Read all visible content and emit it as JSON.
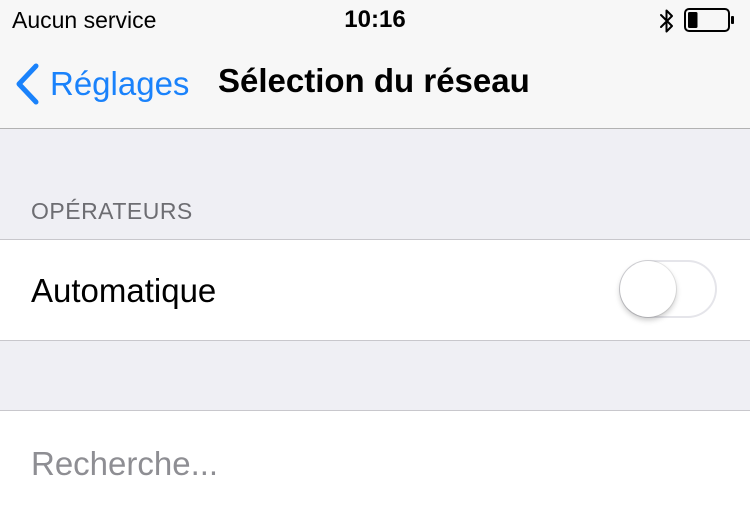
{
  "status_bar": {
    "carrier": "Aucun service",
    "time": "10:16",
    "icons": [
      "bluetooth-icon",
      "battery-icon"
    ],
    "battery_level": 0.25
  },
  "nav_bar": {
    "back_label": "Réglages",
    "back_icon": "chevron-left-icon",
    "title": "Sélection du réseau"
  },
  "section": {
    "header": "OPÉRATEURS"
  },
  "rows": {
    "automatic": {
      "label": "Automatique",
      "toggle_on": false
    },
    "searching": {
      "label": "Recherche..."
    }
  },
  "colors": {
    "accent": "#1a82fb",
    "background": "#efeff4",
    "secondary_text": "#8e8e93"
  }
}
